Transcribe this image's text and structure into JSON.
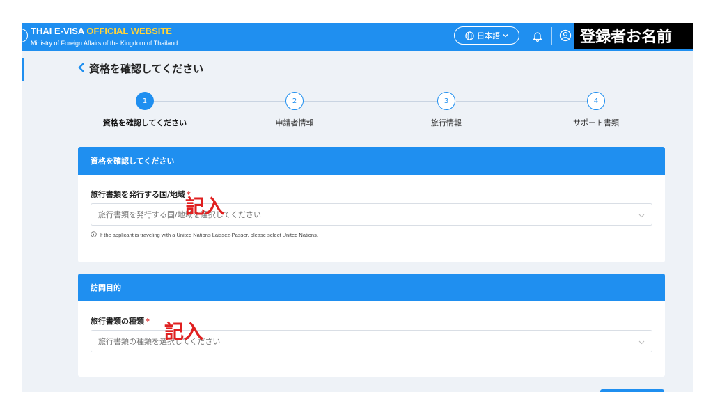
{
  "header": {
    "brand_part1": "THAI E-VISA ",
    "brand_part2": "OFFICIAL WEBSITE",
    "subtitle": "Ministry of Foreign Affairs of the Kingdom of Thailand",
    "language": "日本語",
    "user_name": "登録者お名前",
    "icons": [
      "globe-icon",
      "chevron-down-icon",
      "bell-icon",
      "user-icon"
    ],
    "colors": {
      "bar": "#1f8ff0",
      "brand_highlight": "#ffd43b"
    }
  },
  "page": {
    "back_title": "資格を確認してください"
  },
  "stepper": {
    "steps": [
      {
        "number": "1",
        "label": "資格を確認してください",
        "active": true
      },
      {
        "number": "2",
        "label": "申請者情報",
        "active": false
      },
      {
        "number": "3",
        "label": "旅行情報",
        "active": false
      },
      {
        "number": "4",
        "label": "サポート書類",
        "active": false
      }
    ]
  },
  "section1": {
    "header": "資格を確認してください",
    "field_label": "旅行書類を発行する国/地域",
    "required_mark": "*",
    "placeholder": "旅行書類を発行する国/地域を選択してください",
    "help_text": "If the applicant is traveling with a United Nations Laissez-Passer, please select United Nations.",
    "annotation": "記入"
  },
  "section2": {
    "header": "訪問目的",
    "field_label": "旅行書類の種類",
    "required_mark": "*",
    "placeholder": "旅行書類の種類を選択してください",
    "annotation": "記入"
  }
}
